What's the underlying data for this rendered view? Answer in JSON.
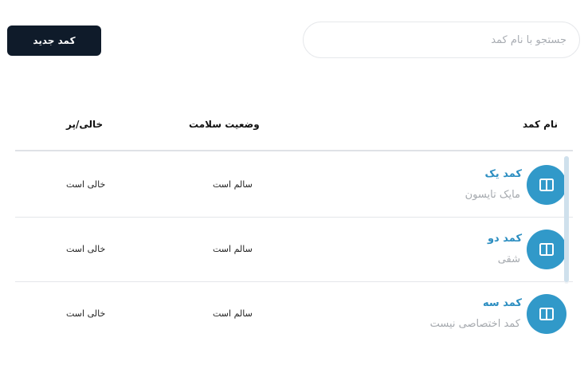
{
  "toolbar": {
    "search_placeholder": "جستجو با نام کمد",
    "new_button_label": "کمد جدید"
  },
  "table": {
    "columns": {
      "name": "نام کمد",
      "health": "وضعیت سلامت",
      "status": "خالی/پر"
    },
    "rows": [
      {
        "title": "کمد یک",
        "subtitle": "مایک تایسون",
        "health": "سالم است",
        "status": "خالی است",
        "icon": "locker-icon"
      },
      {
        "title": "کمد دو",
        "subtitle": "شقی",
        "health": "سالم است",
        "status": "خالی است",
        "icon": "locker-icon"
      },
      {
        "title": "کمد سه",
        "subtitle": "کمد اختصاصی نیست",
        "health": "سالم است",
        "status": "خالی است",
        "icon": "locker-icon"
      }
    ]
  },
  "colors": {
    "accent": "#3199c9",
    "title_text": "#2c8ec1",
    "button_bg": "#0f1b2a"
  }
}
